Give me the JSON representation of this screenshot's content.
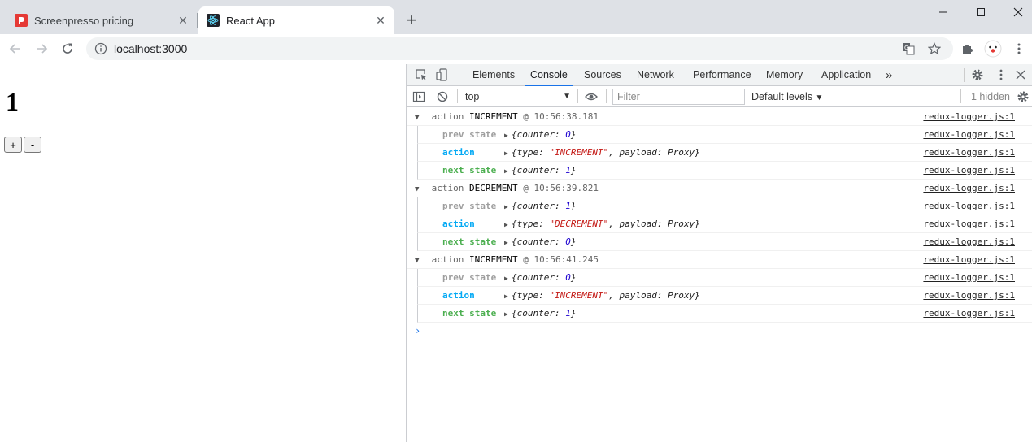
{
  "browser": {
    "tabs": [
      {
        "title": "Screenpresso pricing",
        "favicon": "screenpresso-icon",
        "active": false
      },
      {
        "title": "React App",
        "favicon": "react-icon",
        "active": true
      }
    ],
    "new_tab_label": "+",
    "url": "localhost:3000"
  },
  "page": {
    "counter": "1",
    "plus_label": "+",
    "minus_label": "-"
  },
  "devtools": {
    "tabs": [
      "Elements",
      "Console",
      "Sources",
      "Network",
      "Performance",
      "Memory",
      "Application"
    ],
    "more": "»",
    "selected_tab": "Console",
    "context": "top",
    "filter_placeholder": "Filter",
    "levels": "Default levels",
    "hidden": "1 hidden",
    "source_link": "redux-logger.js:1",
    "groups": [
      {
        "prefix": "action",
        "type": "INCREMENT",
        "time": "@ 10:56:38.181",
        "prev_label": "prev state",
        "prev_obj": "{counter: ",
        "prev_val": "0",
        "prev_end": "}",
        "action_label": "action",
        "action_pre": "{type: ",
        "action_type": "\"INCREMENT\"",
        "action_post": ", payload: Proxy}",
        "next_label": "next state",
        "next_obj": "{counter: ",
        "next_val": "1",
        "next_end": "}"
      },
      {
        "prefix": "action",
        "type": "DECREMENT",
        "time": "@ 10:56:39.821",
        "prev_label": "prev state",
        "prev_obj": "{counter: ",
        "prev_val": "1",
        "prev_end": "}",
        "action_label": "action",
        "action_pre": "{type: ",
        "action_type": "\"DECREMENT\"",
        "action_post": ", payload: Proxy}",
        "next_label": "next state",
        "next_obj": "{counter: ",
        "next_val": "0",
        "next_end": "}"
      },
      {
        "prefix": "action",
        "type": "INCREMENT",
        "time": "@ 10:56:41.245",
        "prev_label": "prev state",
        "prev_obj": "{counter: ",
        "prev_val": "0",
        "prev_end": "}",
        "action_label": "action",
        "action_pre": "{type: ",
        "action_type": "\"INCREMENT\"",
        "action_post": ", payload: Proxy}",
        "next_label": "next state",
        "next_obj": "{counter: ",
        "next_val": "1",
        "next_end": "}"
      }
    ],
    "prompt": "›"
  }
}
